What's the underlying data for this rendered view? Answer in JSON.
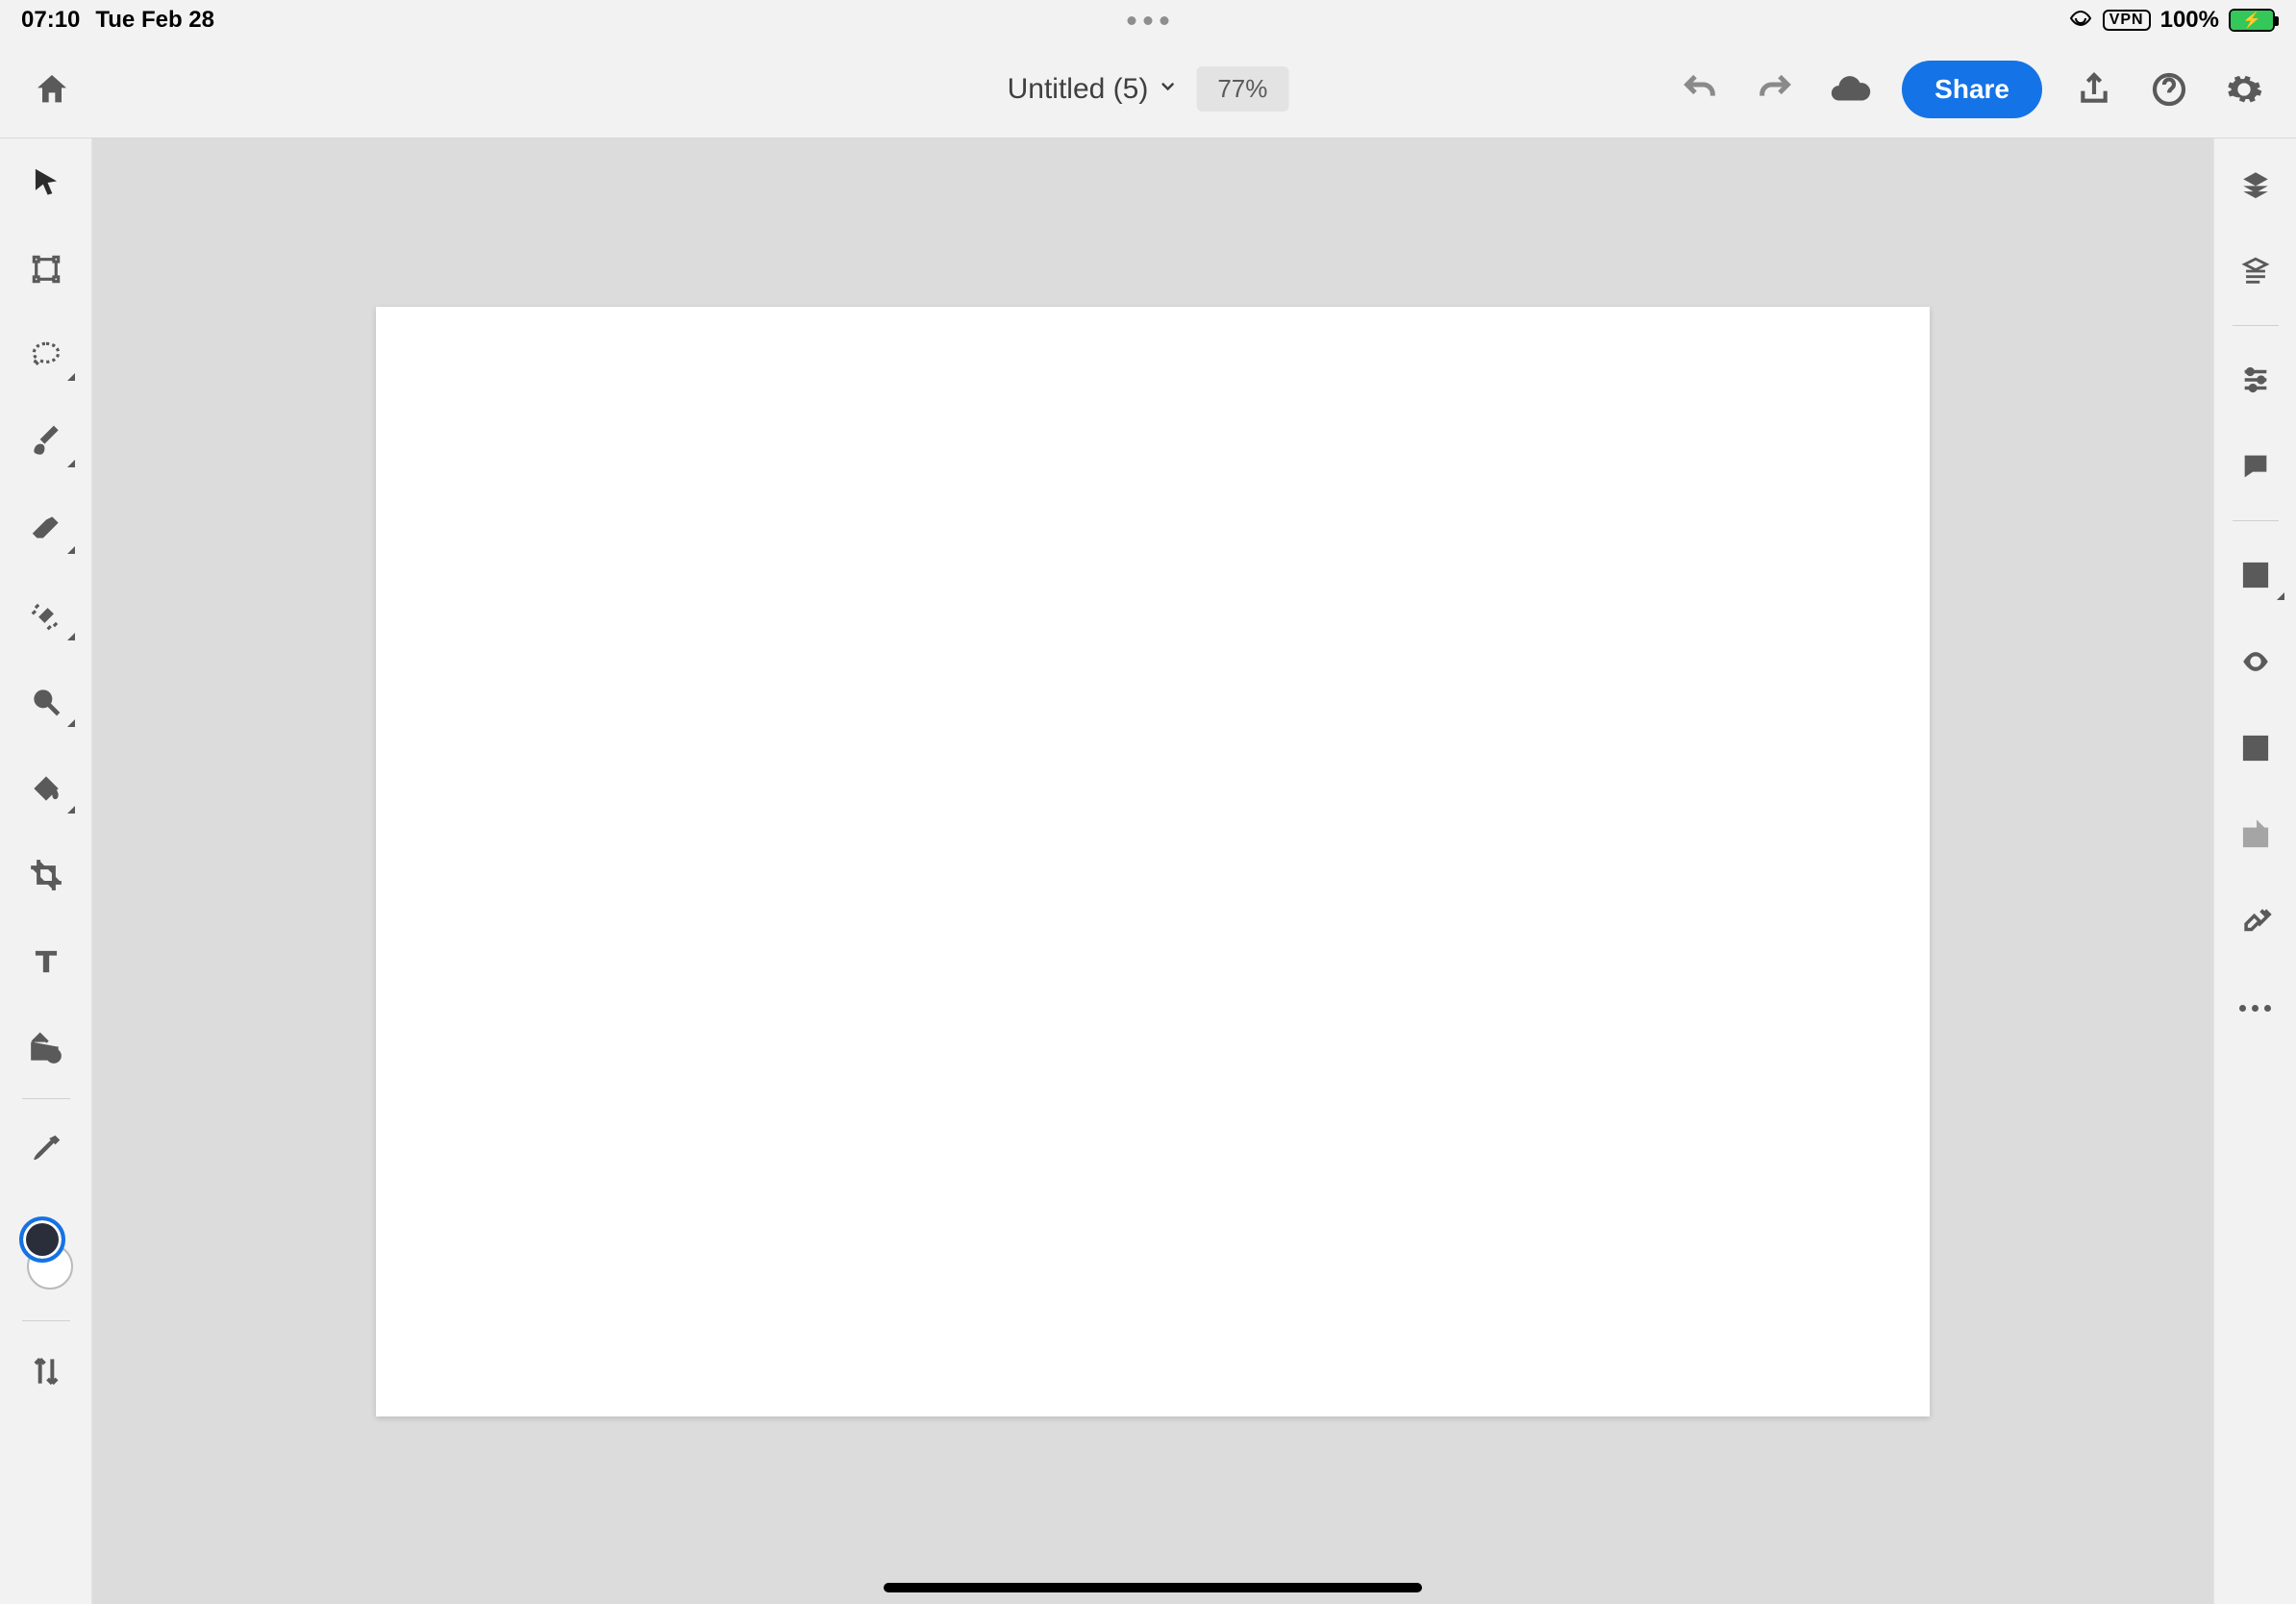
{
  "status": {
    "time": "07:10",
    "date": "Tue Feb 28",
    "vpn": "VPN",
    "battery": "100%"
  },
  "header": {
    "title": "Untitled (5)",
    "zoom": "77%",
    "share_label": "Share"
  },
  "colors": {
    "foreground": "#2a2e3a",
    "background": "#ffffff",
    "accent": "#1473e6"
  }
}
